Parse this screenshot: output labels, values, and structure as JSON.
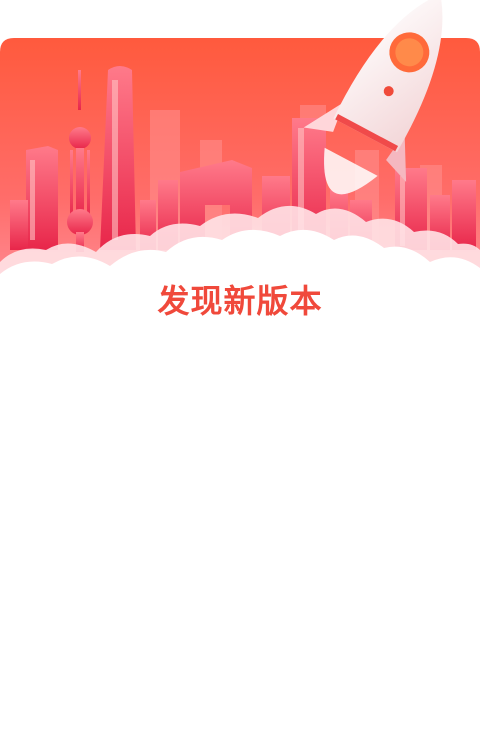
{
  "dialog": {
    "title": "发现新版本"
  },
  "banner": {
    "illustration": "rocket-launch-over-city-skyline",
    "icons": [
      "rocket-icon",
      "city-skyline",
      "cloud-layer"
    ]
  },
  "colors": {
    "banner_gradient_top": "#ff5a3d",
    "banner_gradient_bottom": "#ff8e9a",
    "title": "#f0493b",
    "background": "#ffffff"
  }
}
